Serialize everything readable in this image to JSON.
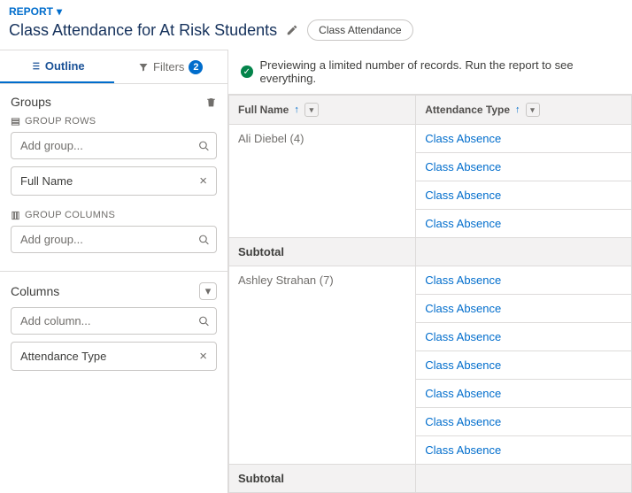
{
  "header": {
    "report_label": "REPORT",
    "title": "Class Attendance for At Risk Students",
    "pill": "Class Attendance"
  },
  "tabs": {
    "outline": "Outline",
    "filters": "Filters",
    "filter_count": "2"
  },
  "groups": {
    "title": "Groups",
    "group_rows_label": "GROUP ROWS",
    "group_cols_label": "GROUP COLUMNS",
    "add_group_placeholder": "Add group...",
    "row_chip": "Full Name"
  },
  "columns": {
    "title": "Columns",
    "add_column_placeholder": "Add column...",
    "chip": "Attendance Type"
  },
  "notice": "Previewing a limited number of records. Run the report to see everything.",
  "table": {
    "h1": "Full Name",
    "h2": "Attendance Type",
    "subtotal": "Subtotal",
    "groups": [
      {
        "name": "Ali Diebel (4)",
        "rows": [
          "Class Absence",
          "Class Absence",
          "Class Absence",
          "Class Absence"
        ]
      },
      {
        "name": "Ashley Strahan (7)",
        "rows": [
          "Class Absence",
          "Class Absence",
          "Class Absence",
          "Class Absence",
          "Class Absence",
          "Class Absence",
          "Class Absence"
        ]
      }
    ]
  }
}
